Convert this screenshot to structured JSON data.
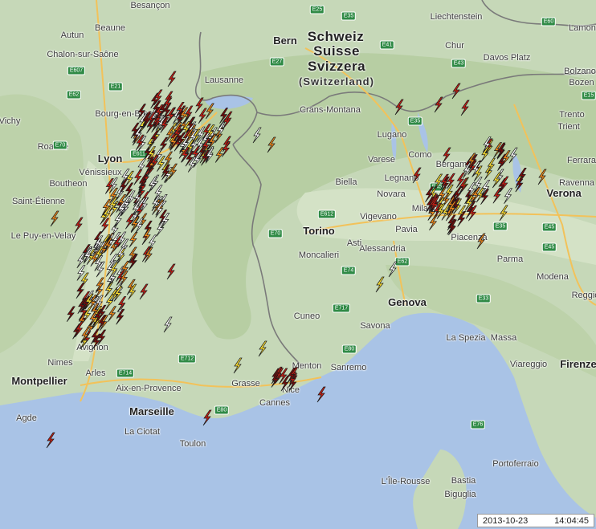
{
  "map": {
    "colors": {
      "land": "#c6d8b8",
      "sea": "#a9c3e6",
      "mountain": "#b9cfa5",
      "border": "#7a7a7a",
      "road": "#f2c25a"
    }
  },
  "labels": {
    "country": [
      {
        "text": "Schweiz"
      },
      {
        "text": "Suisse"
      },
      {
        "text": "Svizzera"
      },
      {
        "text": "(Switzerland)"
      }
    ],
    "big_cities": [
      {
        "text": "Lyon"
      },
      {
        "text": "Torino"
      },
      {
        "text": "Genova"
      },
      {
        "text": "Marseille"
      },
      {
        "text": "Montpellier"
      },
      {
        "text": "Verona"
      },
      {
        "text": "Bern"
      },
      {
        "text": "Firenze"
      }
    ],
    "towns": [
      {
        "text": "Besançon"
      },
      {
        "text": "Beaune"
      },
      {
        "text": "Autun"
      },
      {
        "text": "Chalon-sur-Saône"
      },
      {
        "text": "Lausanne"
      },
      {
        "text": "Liechtenstein"
      },
      {
        "text": "Chur"
      },
      {
        "text": "Davos Platz"
      },
      {
        "text": "Bolzano"
      },
      {
        "text": "Bozen"
      },
      {
        "text": "Bourg-en-Bresse"
      },
      {
        "text": "Vichy"
      },
      {
        "text": "Roanne"
      },
      {
        "text": "Crans-Montana"
      },
      {
        "text": "Lugano"
      },
      {
        "text": "Trento"
      },
      {
        "text": "Trient"
      },
      {
        "text": "Como"
      },
      {
        "text": "Varese"
      },
      {
        "text": "Bergamo"
      },
      {
        "text": "Vénissieux"
      },
      {
        "text": "Boutheon"
      },
      {
        "text": "Saint-Étienne"
      },
      {
        "text": "Biella"
      },
      {
        "text": "Legnano"
      },
      {
        "text": "Novara"
      },
      {
        "text": "Milano"
      },
      {
        "text": "Le Puy-en-Velay"
      },
      {
        "text": "Vigevano"
      },
      {
        "text": "Pavia"
      },
      {
        "text": "Piacenza"
      },
      {
        "text": "Moncalieri"
      },
      {
        "text": "Alessandria"
      },
      {
        "text": "Parma"
      },
      {
        "text": "Modena"
      },
      {
        "text": "Asti"
      },
      {
        "text": "Cuneo"
      },
      {
        "text": "Savona"
      },
      {
        "text": "La Spezia"
      },
      {
        "text": "Massa"
      },
      {
        "text": "Viareggio"
      },
      {
        "text": "Nimes"
      },
      {
        "text": "Arles"
      },
      {
        "text": "Avignon"
      },
      {
        "text": "Aix-en-Provence"
      },
      {
        "text": "Grasse"
      },
      {
        "text": "Nice"
      },
      {
        "text": "Menton"
      },
      {
        "text": "Sanremo"
      },
      {
        "text": "Cannes"
      },
      {
        "text": "Agde"
      },
      {
        "text": "La Ciotat"
      },
      {
        "text": "Toulon"
      },
      {
        "text": "Portoferraio"
      },
      {
        "text": "L'Île-Rousse"
      },
      {
        "text": "Bastia"
      },
      {
        "text": "Biguglia"
      },
      {
        "text": "Ravenna"
      },
      {
        "text": "Ferrara"
      },
      {
        "text": "Lamon"
      },
      {
        "text": "Reggio"
      }
    ],
    "road_shields": [
      {
        "text": "E25"
      },
      {
        "text": "E35"
      },
      {
        "text": "E60"
      },
      {
        "text": "E27"
      },
      {
        "text": "E41"
      },
      {
        "text": "E43"
      },
      {
        "text": "E21"
      },
      {
        "text": "E62"
      },
      {
        "text": "E607"
      },
      {
        "text": "E70"
      },
      {
        "text": "E611"
      },
      {
        "text": "E35"
      },
      {
        "text": "E45"
      },
      {
        "text": "E612"
      },
      {
        "text": "E74"
      },
      {
        "text": "E62"
      },
      {
        "text": "E717"
      },
      {
        "text": "E80"
      },
      {
        "text": "E714"
      },
      {
        "text": "E712"
      },
      {
        "text": "E80"
      },
      {
        "text": "E33"
      },
      {
        "text": "E35"
      },
      {
        "text": "E45"
      },
      {
        "text": "E76"
      },
      {
        "text": "E15"
      },
      {
        "text": "E70"
      },
      {
        "text": "E45"
      }
    ]
  },
  "lightning": {
    "colors": {
      "white": "#ffffff",
      "yellow": "#ffe233",
      "orange": "#f08a1c",
      "red": "#c81e14",
      "dark": "#7a0c0a"
    }
  },
  "timestamp": {
    "date": "2013-10-23",
    "time": "14:04:45"
  }
}
